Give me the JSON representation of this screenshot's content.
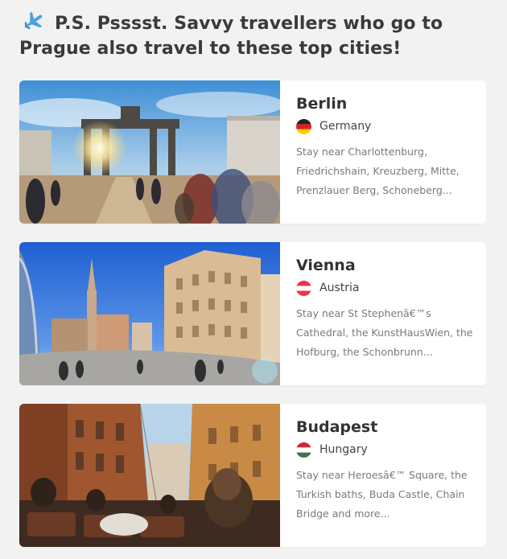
{
  "header": {
    "title": "P.S. Psssst. Savvy travellers who go to Prague also travel to these top cities!",
    "icon": "airplane-icon"
  },
  "cities": [
    {
      "name": "Berlin",
      "country": "Germany",
      "flag": "germany-flag-icon",
      "description": "Stay near Charlottenburg, Friedrichshain, Kreuzberg, Mitte, Prenzlauer Berg, Schoneberg..."
    },
    {
      "name": "Vienna",
      "country": "Austria",
      "flag": "austria-flag-icon",
      "description": "Stay near St Stephenâ€™s Cathedral, the KunstHausWien, the Hofburg, the Schonbrunn..."
    },
    {
      "name": "Budapest",
      "country": "Hungary",
      "flag": "hungary-flag-icon",
      "description": "Stay near Heroesâ€™ Square, the Turkish baths, Buda Castle, Chain Bridge and more..."
    }
  ],
  "colors": {
    "background": "#f2f2f2",
    "card": "#ffffff",
    "heading": "#3a3a3a",
    "muted_text": "#7a7a7a",
    "plane": "#4aa3df"
  }
}
